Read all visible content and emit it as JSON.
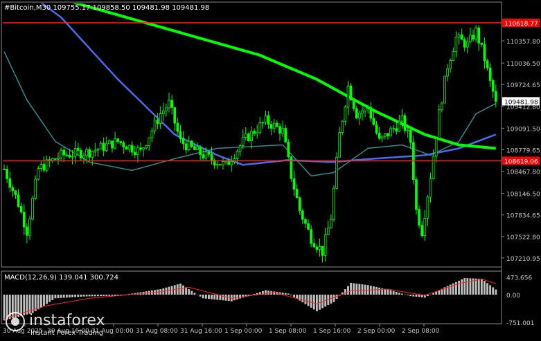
{
  "header": {
    "symbol_info": "#Bitcoin,M30  109755.17 109858.50 109481.98 109481.98"
  },
  "colors": {
    "background": "#000000",
    "bull": "#00ff00",
    "bear": "#00ff00",
    "ma_fast": "#2a8f8f",
    "ma_mid": "#4a6cf0",
    "ma_slow": "#00ff00",
    "hline": "#ff2020",
    "price_tag_red": "#ff0000",
    "price_tag_current": "#ffffff",
    "axis_text": "#c8c8c8",
    "macd_hist": "#c0c0c0",
    "macd_signal": "#ff2020"
  },
  "price_axis": {
    "ticks": [
      "110357.80",
      "110036.50",
      "109724.65",
      "109412.80",
      "109091.50",
      "108779.65",
      "108467.80",
      "108146.50",
      "107834.65",
      "107522.80",
      "107210.95"
    ],
    "level_top": "110618.77",
    "level_bottom": "108619.06",
    "current": "109481.98"
  },
  "time_axis": {
    "ticks": [
      "30 Aug 2025",
      "30 Aug 16:00",
      "31 Aug 00:00",
      "31 Aug 08:00",
      "31 Aug 16:00",
      "1 Sep 00:00",
      "1 Sep 08:00",
      "1 Sep 16:00",
      "2 Sep 00:00",
      "2 Sep 08:00"
    ]
  },
  "macd": {
    "label": "MACD(12,26,9) 139.041 300.724",
    "ticks": [
      "473.656",
      "0.00",
      "-751.001"
    ]
  },
  "watermark": {
    "brand": "instaforex",
    "tagline": "Instant Forex Trading"
  },
  "chart_data": {
    "type": "candlestick",
    "title": "#Bitcoin,M30",
    "ylim": [
      107100,
      110900
    ],
    "horizontal_levels": [
      110618.77,
      108619.06
    ],
    "last_close": 109481.98,
    "price_keypoints": [
      {
        "bar": 0,
        "price": 108500
      },
      {
        "bar": 5,
        "price": 108000
      },
      {
        "bar": 8,
        "price": 107600
      },
      {
        "bar": 12,
        "price": 108500
      },
      {
        "bar": 20,
        "price": 108700
      },
      {
        "bar": 30,
        "price": 108750
      },
      {
        "bar": 40,
        "price": 108900
      },
      {
        "bar": 48,
        "price": 108750
      },
      {
        "bar": 55,
        "price": 109300
      },
      {
        "bar": 58,
        "price": 109450
      },
      {
        "bar": 62,
        "price": 108900
      },
      {
        "bar": 70,
        "price": 108700
      },
      {
        "bar": 78,
        "price": 108550
      },
      {
        "bar": 84,
        "price": 108900
      },
      {
        "bar": 92,
        "price": 109200
      },
      {
        "bar": 98,
        "price": 109050
      },
      {
        "bar": 101,
        "price": 108400
      },
      {
        "bar": 104,
        "price": 107900
      },
      {
        "bar": 108,
        "price": 107500
      },
      {
        "bar": 112,
        "price": 107300
      },
      {
        "bar": 115,
        "price": 107800
      },
      {
        "bar": 118,
        "price": 109000
      },
      {
        "bar": 121,
        "price": 109700
      },
      {
        "bar": 124,
        "price": 109300
      },
      {
        "bar": 128,
        "price": 109400
      },
      {
        "bar": 132,
        "price": 108900
      },
      {
        "bar": 136,
        "price": 109050
      },
      {
        "bar": 140,
        "price": 109200
      },
      {
        "bar": 143,
        "price": 108900
      },
      {
        "bar": 145,
        "price": 107900
      },
      {
        "bar": 147,
        "price": 107600
      },
      {
        "bar": 150,
        "price": 108400
      },
      {
        "bar": 153,
        "price": 109300
      },
      {
        "bar": 156,
        "price": 110000
      },
      {
        "bar": 159,
        "price": 110400
      },
      {
        "bar": 163,
        "price": 110300
      },
      {
        "bar": 166,
        "price": 110500
      },
      {
        "bar": 169,
        "price": 110100
      },
      {
        "bar": 171,
        "price": 109750
      },
      {
        "bar": 173,
        "price": 109481.98
      }
    ],
    "ma_slow_keypoints": [
      {
        "bar": 0,
        "price": 111200
      },
      {
        "bar": 30,
        "price": 110850
      },
      {
        "bar": 60,
        "price": 110500
      },
      {
        "bar": 90,
        "price": 110150
      },
      {
        "bar": 110,
        "price": 109800
      },
      {
        "bar": 130,
        "price": 109350
      },
      {
        "bar": 148,
        "price": 109000
      },
      {
        "bar": 160,
        "price": 108850
      },
      {
        "bar": 173,
        "price": 108800
      }
    ],
    "ma_mid_keypoints": [
      {
        "bar": 0,
        "price": 111300
      },
      {
        "bar": 20,
        "price": 110700
      },
      {
        "bar": 40,
        "price": 109800
      },
      {
        "bar": 60,
        "price": 109000
      },
      {
        "bar": 75,
        "price": 108700
      },
      {
        "bar": 84,
        "price": 108560
      },
      {
        "bar": 100,
        "price": 108630
      },
      {
        "bar": 115,
        "price": 108600
      },
      {
        "bar": 130,
        "price": 108650
      },
      {
        "bar": 148,
        "price": 108700
      },
      {
        "bar": 160,
        "price": 108800
      },
      {
        "bar": 173,
        "price": 109000
      }
    ],
    "ma_fast_keypoints": [
      {
        "bar": 0,
        "price": 110200
      },
      {
        "bar": 8,
        "price": 109500
      },
      {
        "bar": 18,
        "price": 108900
      },
      {
        "bar": 30,
        "price": 108600
      },
      {
        "bar": 45,
        "price": 108480
      },
      {
        "bar": 60,
        "price": 108650
      },
      {
        "bar": 75,
        "price": 108800
      },
      {
        "bar": 98,
        "price": 108850
      },
      {
        "bar": 108,
        "price": 108400
      },
      {
        "bar": 116,
        "price": 108450
      },
      {
        "bar": 128,
        "price": 108800
      },
      {
        "bar": 140,
        "price": 108850
      },
      {
        "bar": 150,
        "price": 108700
      },
      {
        "bar": 160,
        "price": 108900
      },
      {
        "bar": 166,
        "price": 109300
      },
      {
        "bar": 173,
        "price": 109450
      }
    ],
    "macd_keypoints": [
      {
        "bar": 0,
        "value": -700
      },
      {
        "bar": 10,
        "value": -500
      },
      {
        "bar": 18,
        "value": -100
      },
      {
        "bar": 28,
        "value": -50
      },
      {
        "bar": 40,
        "value": -30
      },
      {
        "bar": 55,
        "value": 150
      },
      {
        "bar": 62,
        "value": 300
      },
      {
        "bar": 70,
        "value": -100
      },
      {
        "bar": 80,
        "value": -180
      },
      {
        "bar": 92,
        "value": 120
      },
      {
        "bar": 100,
        "value": 30
      },
      {
        "bar": 110,
        "value": -450
      },
      {
        "bar": 116,
        "value": -200
      },
      {
        "bar": 122,
        "value": 320
      },
      {
        "bar": 128,
        "value": 260
      },
      {
        "bar": 136,
        "value": 120
      },
      {
        "bar": 143,
        "value": -40
      },
      {
        "bar": 148,
        "value": -80
      },
      {
        "bar": 155,
        "value": 200
      },
      {
        "bar": 162,
        "value": 450
      },
      {
        "bar": 168,
        "value": 430
      },
      {
        "bar": 173,
        "value": 139
      }
    ],
    "macd_signal_keypoints": [
      {
        "bar": 0,
        "value": -650
      },
      {
        "bar": 15,
        "value": -300
      },
      {
        "bar": 30,
        "value": -100
      },
      {
        "bar": 55,
        "value": 80
      },
      {
        "bar": 65,
        "value": 200
      },
      {
        "bar": 80,
        "value": -100
      },
      {
        "bar": 95,
        "value": 60
      },
      {
        "bar": 110,
        "value": -250
      },
      {
        "bar": 122,
        "value": 100
      },
      {
        "bar": 135,
        "value": 150
      },
      {
        "bar": 148,
        "value": -20
      },
      {
        "bar": 160,
        "value": 300
      },
      {
        "bar": 168,
        "value": 420
      },
      {
        "bar": 173,
        "value": 300
      }
    ],
    "macd_ylim": [
      -751,
      600
    ],
    "bar_count": 174
  }
}
